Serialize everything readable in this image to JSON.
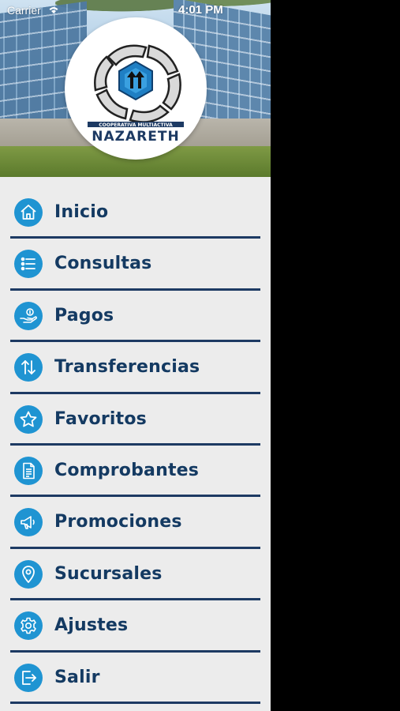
{
  "status_bar": {
    "carrier": "Carrier",
    "time": "4:01 PM"
  },
  "header": {
    "logo": {
      "org_line": "COOPERATIVA MULTIACTIVA",
      "name": "NAZARETH"
    }
  },
  "menu": {
    "items": [
      {
        "label": "Inicio",
        "icon": "home-icon"
      },
      {
        "label": "Consultas",
        "icon": "list-icon"
      },
      {
        "label": "Pagos",
        "icon": "hand-coin-icon"
      },
      {
        "label": "Transferencias",
        "icon": "transfer-arrows-icon"
      },
      {
        "label": "Favoritos",
        "icon": "star-icon"
      },
      {
        "label": "Comprobantes",
        "icon": "document-icon"
      },
      {
        "label": "Promociones",
        "icon": "megaphone-icon"
      },
      {
        "label": "Sucursales",
        "icon": "location-pin-icon"
      },
      {
        "label": "Ajustes",
        "icon": "gear-icon"
      },
      {
        "label": "Salir",
        "icon": "logout-icon"
      }
    ]
  },
  "colors": {
    "accent": "#1f94d2",
    "text": "#143a62",
    "divider": "#1d3a63",
    "drawer_bg": "#ececec"
  }
}
